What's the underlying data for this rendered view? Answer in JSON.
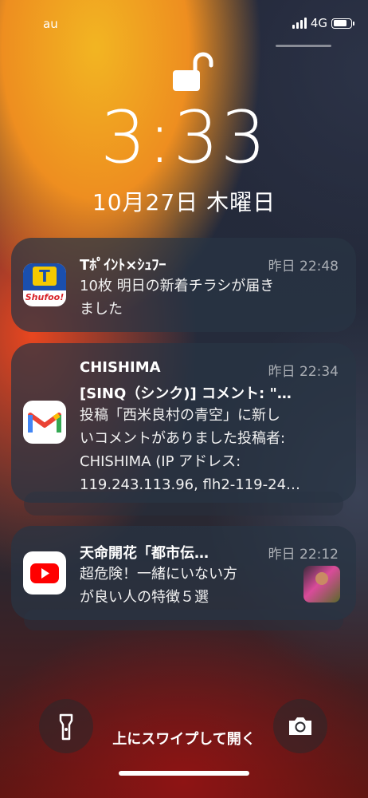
{
  "status_bar": {
    "carrier": "au",
    "network": "4G",
    "battery_level": 0.8
  },
  "lockscreen": {
    "time": "3:33",
    "date": "10月27日 木曜日"
  },
  "notifications": [
    {
      "app": "Tポイント×Shufoo!",
      "icon": "shufoo-icon",
      "icon_text": "Shufoo!",
      "title": "Tﾎﾟｲﾝﾄ×ｼｭﾌｰ",
      "time": "昨日 22:48",
      "body": [
        "10枚 明日の新着チラシが届き",
        "ました"
      ]
    },
    {
      "app": "Gmail",
      "icon": "gmail-icon",
      "title": "CHISHIMA",
      "subtitle": "[SINQ（シンク)] コメント: \"…",
      "time": "昨日 22:34",
      "body": [
        "投稿「西米良村の青空」に新し",
        "いコメントがありました投稿者:",
        "CHISHIMA (IP アドレス:",
        "119.243.113.96, flh2-119-24…"
      ]
    },
    {
      "app": "YouTube",
      "icon": "youtube-icon",
      "title": "天命開花「都市伝…",
      "time": "昨日 22:12",
      "body": [
        "超危険！一緒にいない方",
        "が良い人の特徴５選"
      ]
    }
  ],
  "bottom": {
    "swipe_text": "上にスワイプして開く"
  },
  "colors": {
    "gmail_red": "#ea4335",
    "youtube_red": "#ff0000",
    "shufoo_blue": "#1a4fae",
    "shufoo_yellow": "#f6c900"
  }
}
